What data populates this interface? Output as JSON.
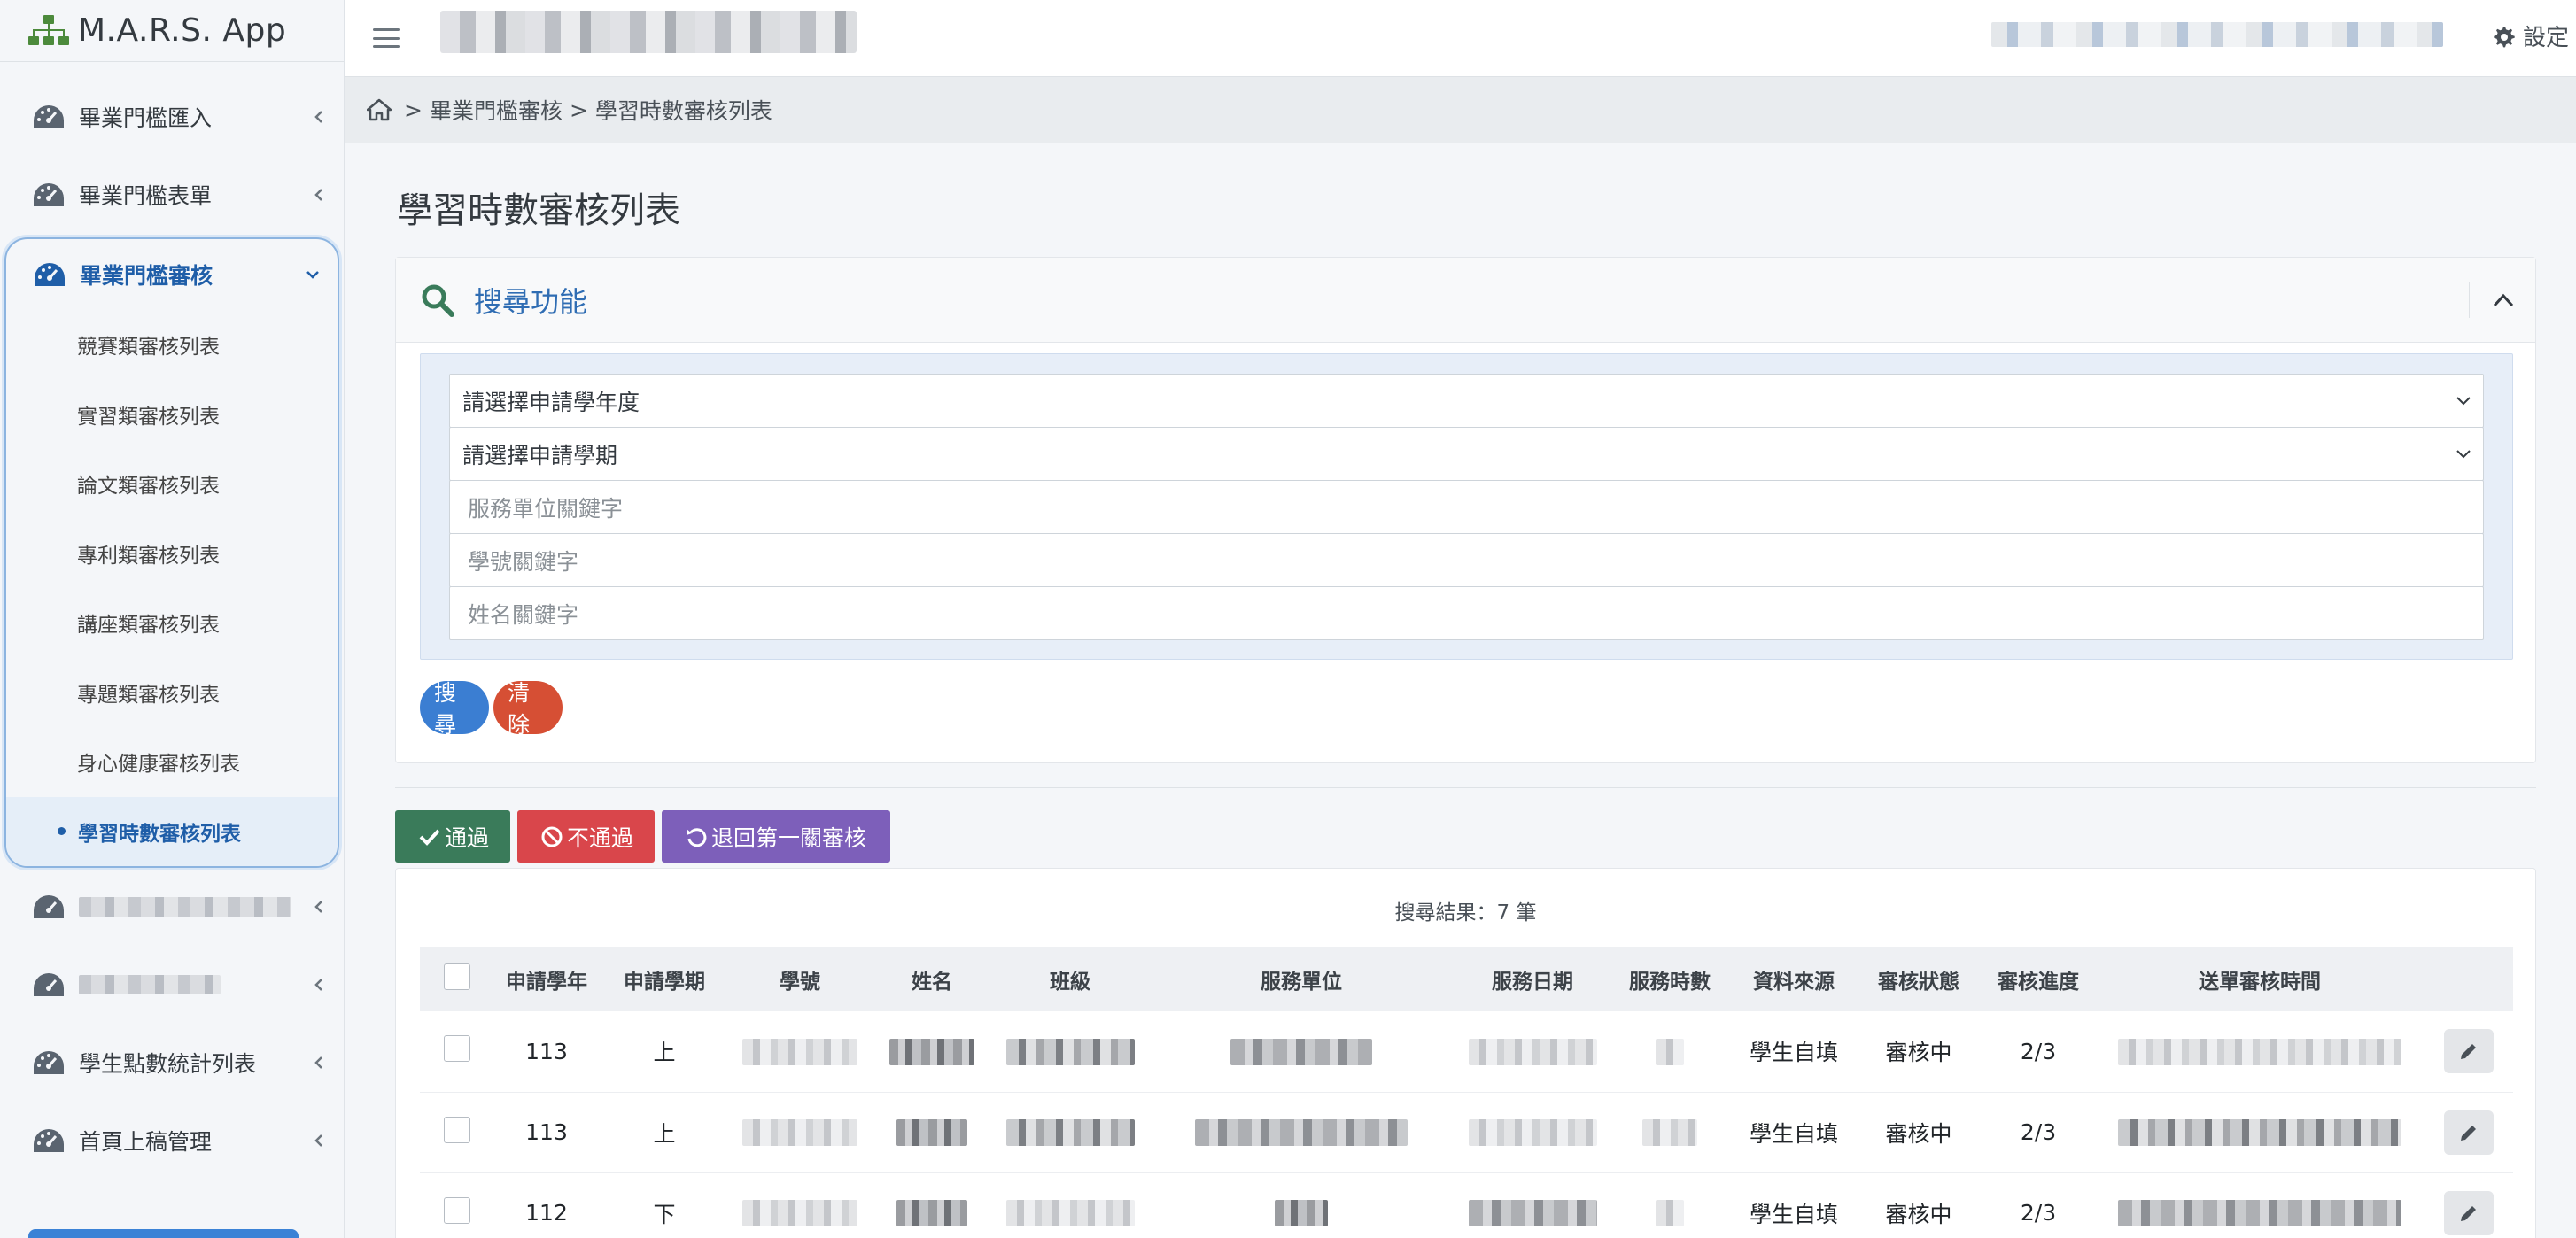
{
  "app": {
    "title": "M.A.R.S. App"
  },
  "sidebar": {
    "items_top": [
      {
        "label": "畢業門檻匯入"
      },
      {
        "label": "畢業門檻表單"
      }
    ],
    "active_group": {
      "label": "畢業門檻審核",
      "sub_items": [
        {
          "label": "競賽類審核列表"
        },
        {
          "label": "實習類審核列表"
        },
        {
          "label": "論文類審核列表"
        },
        {
          "label": "專利類審核列表"
        },
        {
          "label": "講座類審核列表"
        },
        {
          "label": "專題類審核列表"
        },
        {
          "label": "身心健康審核列表"
        },
        {
          "label": "學習時數審核列表",
          "active": true
        }
      ]
    },
    "items_bottom": [
      {
        "label": "學生點數統計列表"
      },
      {
        "label": "首頁上稿管理"
      }
    ]
  },
  "topbar": {
    "settings_label": "設定"
  },
  "breadcrumb": {
    "sep": ">",
    "level1": "畢業門檻審核",
    "level2": "學習時數審核列表"
  },
  "page": {
    "title": "學習時數審核列表"
  },
  "search": {
    "title": "搜尋功能",
    "year_select": "請選擇申請學年度",
    "term_select": "請選擇申請學期",
    "unit_placeholder": "服務單位關鍵字",
    "student_id_placeholder": "學號關鍵字",
    "name_placeholder": "姓名關鍵字",
    "search_button": "搜尋",
    "clear_button": "清除"
  },
  "actions": {
    "approve": "通過",
    "reject": "不通過",
    "return": "退回第一關審核"
  },
  "results": {
    "count_text": "搜尋結果：7 筆",
    "columns": [
      "申請學年",
      "申請學期",
      "學號",
      "姓名",
      "班級",
      "服務單位",
      "服務日期",
      "服務時數",
      "資料來源",
      "審核狀態",
      "審核進度",
      "送單審核時間"
    ],
    "rows": [
      {
        "year": "113",
        "term": "上",
        "source": "學生自填",
        "status": "審核中",
        "progress": "2/3"
      },
      {
        "year": "113",
        "term": "上",
        "source": "學生自填",
        "status": "審核中",
        "progress": "2/3"
      },
      {
        "year": "112",
        "term": "下",
        "source": "學生自填",
        "status": "審核中",
        "progress": "2/3"
      }
    ]
  },
  "colors": {
    "accent": "#1f5ea8",
    "approve": "#3a7b5a",
    "reject": "#d9464b",
    "return": "#7d5fba",
    "search_btn": "#3b7ed2",
    "clear_btn": "#d64f34"
  }
}
